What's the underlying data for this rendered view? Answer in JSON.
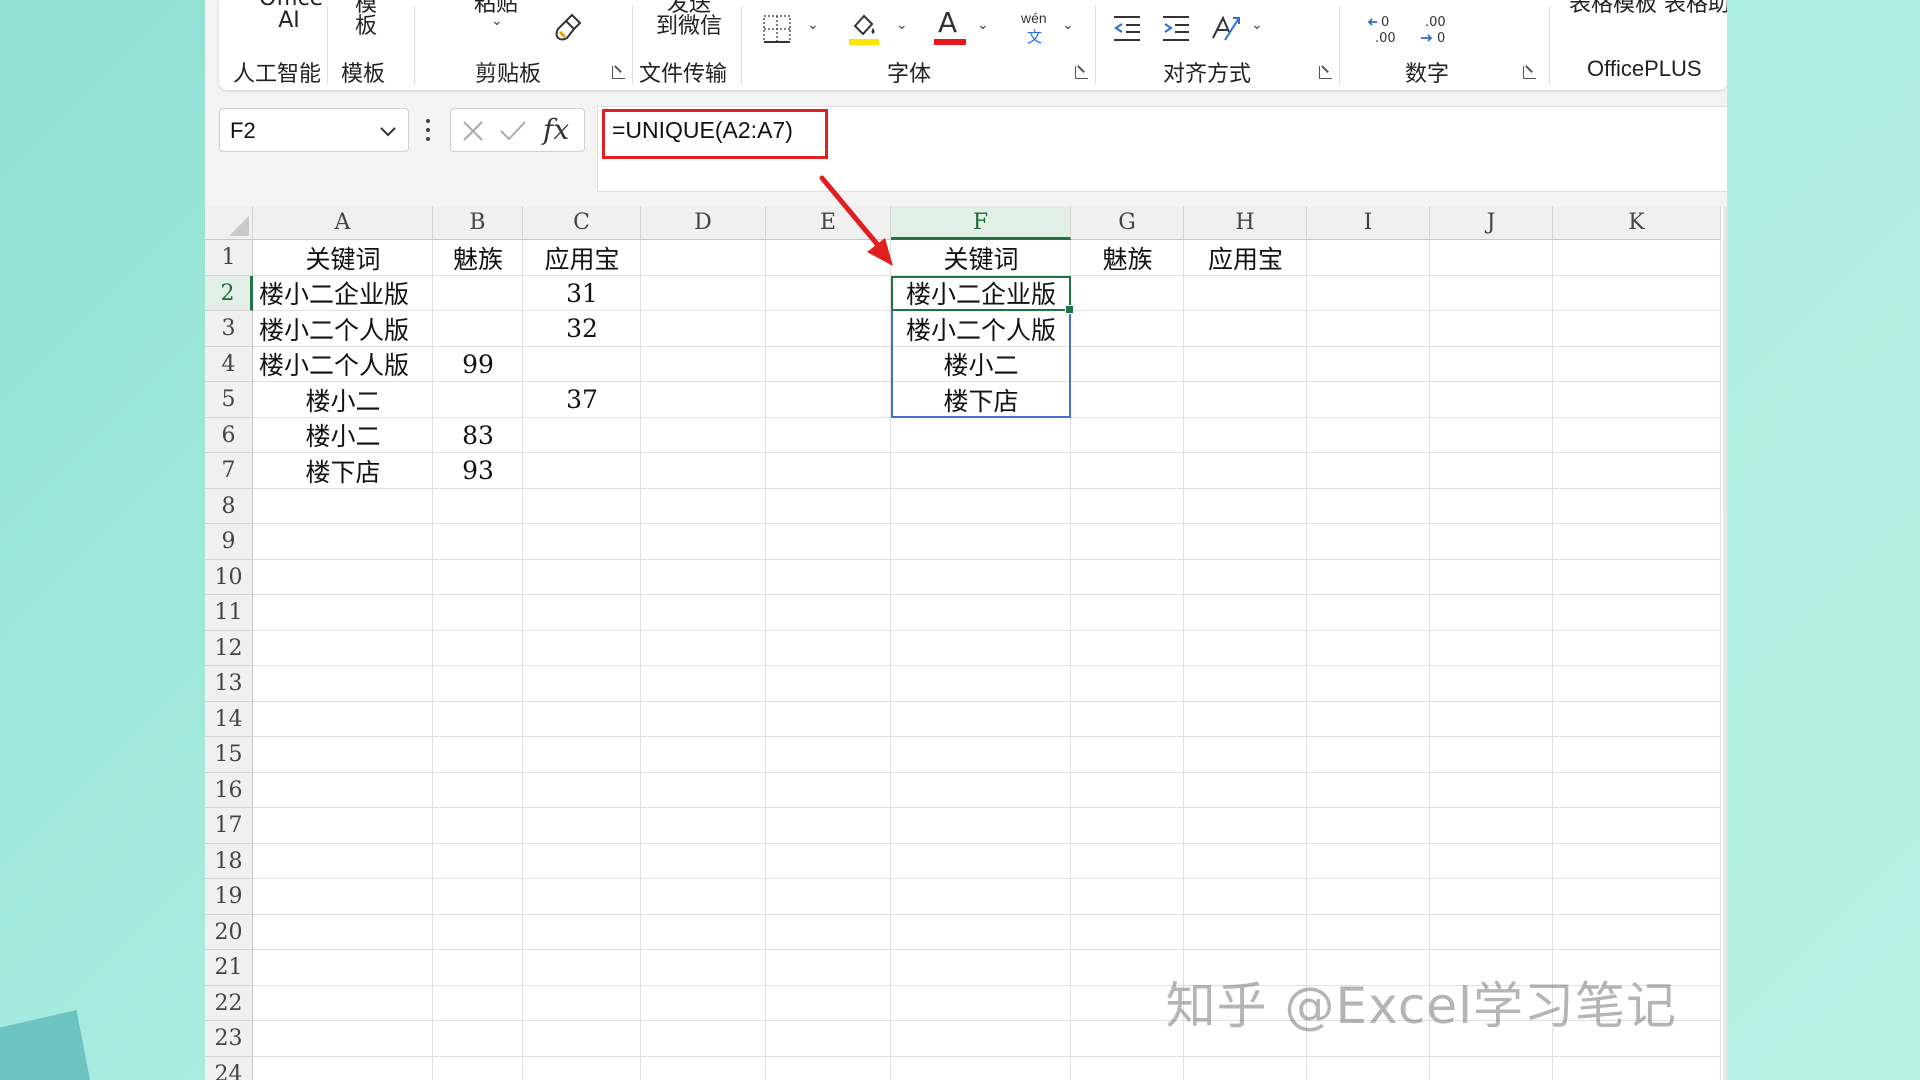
{
  "ribbon": {
    "office_ai_top": "Office",
    "office_ai_label": "AI",
    "template_top": "模",
    "template_label": "板",
    "paste_top": "粘贴",
    "send_top": "发送",
    "send_label": "到微信",
    "officeplus_top": "表格模板 表格助手",
    "groups": {
      "ai": "人工智能",
      "template": "模板",
      "clipboard": "剪贴板",
      "file_transfer": "文件传输",
      "font": "字体",
      "alignment": "对齐方式",
      "number": "数字",
      "officeplus": "OfficePLUS"
    },
    "phonetic_icon_text": "wén",
    "phonetic_icon_sub": "文",
    "font_color_letter": "A",
    "colors": {
      "highlight": "#ffe600",
      "font_color": "#e51b1b"
    }
  },
  "formula_bar": {
    "name_box": "F2",
    "formula": "=UNIQUE(A2:A7)",
    "fx_label": "fx"
  },
  "sheet": {
    "columns": [
      "A",
      "B",
      "C",
      "D",
      "E",
      "F",
      "G",
      "H",
      "I",
      "J",
      "K"
    ],
    "selected_column": "F",
    "rows": [
      "1",
      "2",
      "3",
      "4",
      "5",
      "6",
      "7",
      "8",
      "9",
      "10",
      "11",
      "12",
      "13",
      "14",
      "15",
      "16",
      "17",
      "18",
      "19",
      "20",
      "21",
      "22",
      "23",
      "24"
    ],
    "selected_row": "2",
    "cells": {
      "A1": "关键词",
      "B1": "魅族",
      "C1": "应用宝",
      "A2": "楼小二企业版",
      "C2": "31",
      "A3": "楼小二个人版",
      "C3": "32",
      "A4": "楼小二个人版",
      "B4": "99",
      "A5": "楼小二",
      "C5": "37",
      "A6": "楼小二",
      "B6": "83",
      "A7": "楼下店",
      "B7": "93",
      "F1": "关键词",
      "G1": "魅族",
      "H1": "应用宝",
      "F2": "楼小二企业版",
      "F3": "楼小二个人版",
      "F4": "楼小二",
      "F5": "楼下店"
    },
    "active_cell": "F2",
    "spill_range": "F2:F5",
    "colors": {
      "selection": "#217346",
      "spill": "#4472c4",
      "annotation": "#e02020"
    }
  },
  "watermark": "知乎 @Excel学习笔记"
}
